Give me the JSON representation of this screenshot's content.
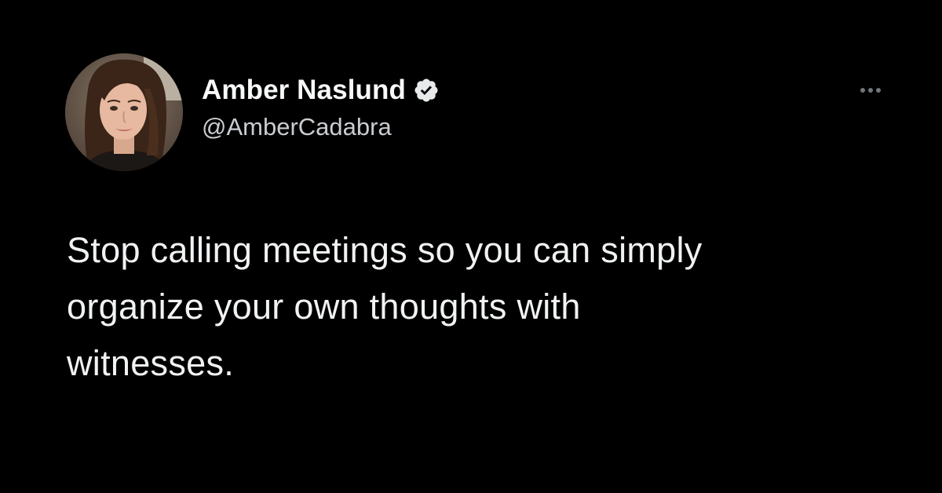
{
  "tweet": {
    "author": {
      "display_name": "Amber Naslund",
      "handle": "@AmberCadabra",
      "verified": true,
      "avatar_icon": "profile-photo"
    },
    "text": "Stop calling meetings so you can simply\norganize your own thoughts with\nwitnesses.",
    "more_icon": "ellipsis-icon"
  },
  "colors": {
    "background": "#000000",
    "text_primary": "#f0f2f3",
    "text_secondary": "#c9cdd1",
    "verified_badge": "#e7e9ea"
  }
}
